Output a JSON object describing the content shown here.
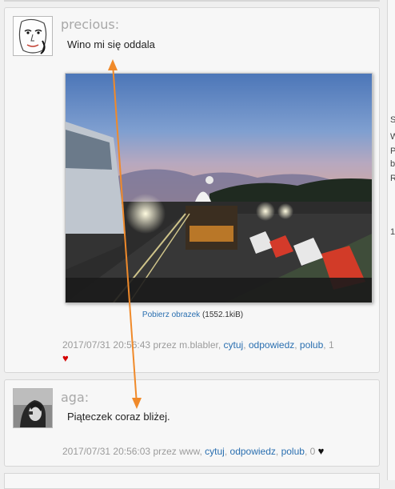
{
  "posts": [
    {
      "author": "precious:",
      "message": "Wino mi się oddala",
      "image_caption_link": "Pobierz obrazek",
      "image_caption_size": "(1552.1kiB)",
      "meta": {
        "timestamp": "2017/07/31 20:56:43",
        "by": "przez",
        "user": "m.blabler",
        "quote": "cytuj",
        "reply": "odpowiedz",
        "like": "polub",
        "like_count": "1"
      },
      "heart_color": "#d40000"
    },
    {
      "author": "aga:",
      "message": "Piąteczek coraz bliżej.",
      "meta": {
        "timestamp": "2017/07/31 20:56:03",
        "by": "przez",
        "user": "www",
        "quote": "cytuj",
        "reply": "odpowiedz",
        "like": "polub",
        "like_count": "0"
      },
      "heart_color": "#111111"
    }
  ],
  "sep": ", ",
  "heart_glyph": "♥",
  "right_panel_fragments": [
    "S",
    "W",
    "P",
    "b",
    "R",
    "1"
  ],
  "annotation_color": "#f08a2a"
}
